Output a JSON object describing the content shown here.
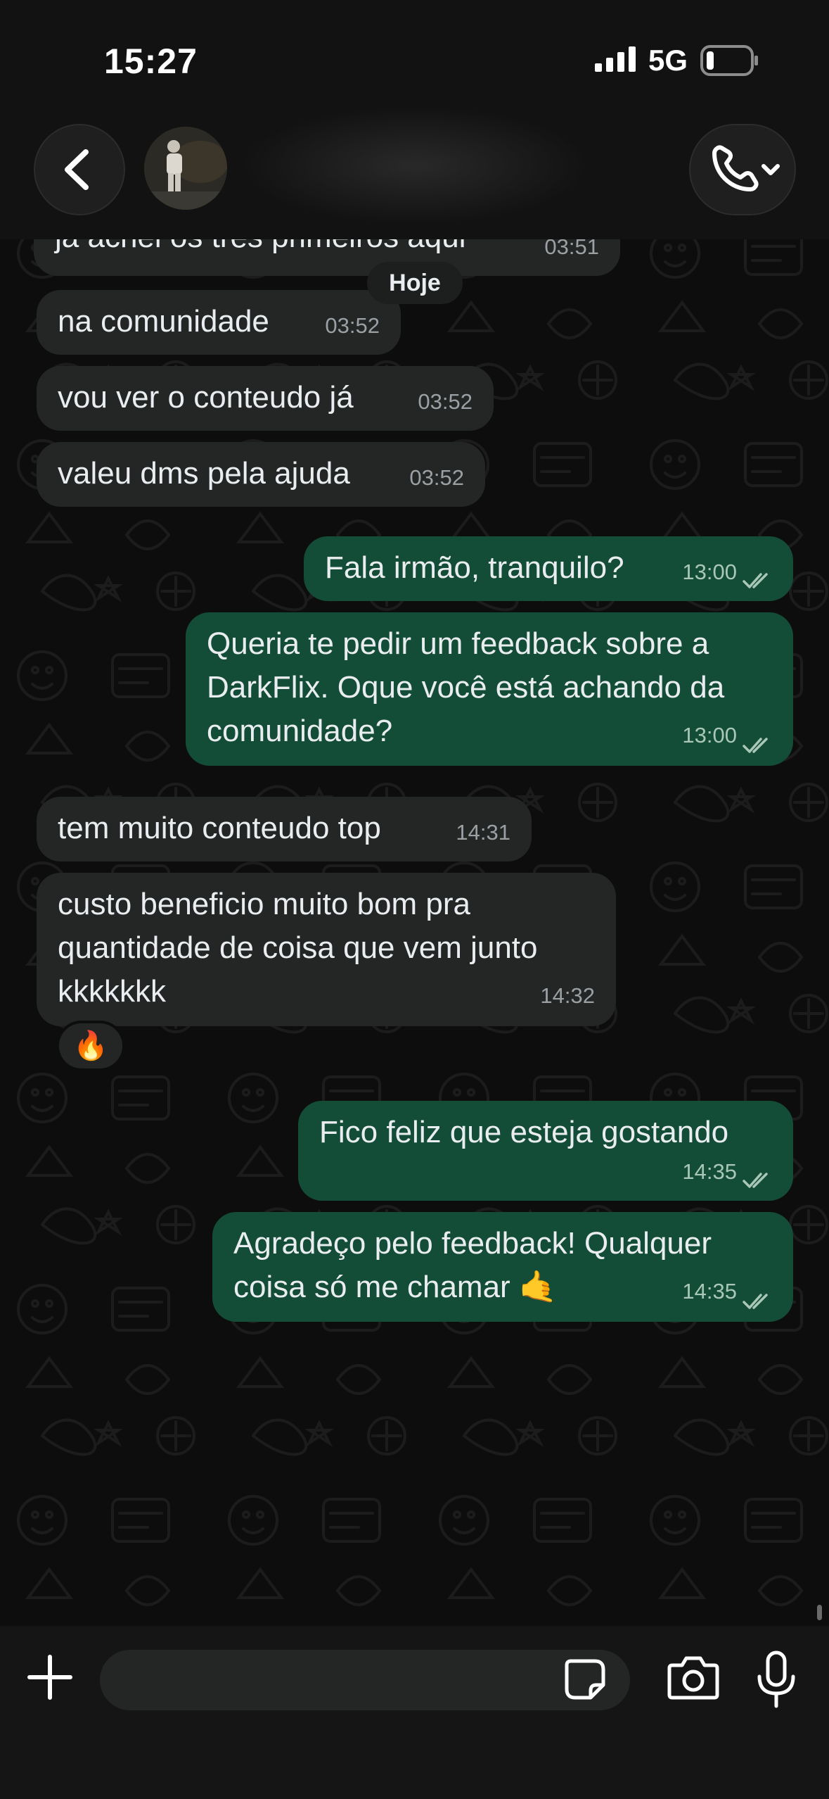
{
  "status_bar": {
    "time": "15:27",
    "network": "5G"
  },
  "chat": {
    "date_pill": "Hoje",
    "messages": [
      {
        "direction": "in",
        "lines": [
          "já achei os três primeiros aqui"
        ],
        "time": "03:51"
      },
      {
        "direction": "in",
        "lines": [
          "na comunidade"
        ],
        "time": "03:52"
      },
      {
        "direction": "in",
        "lines": [
          "vou ver o conteudo já"
        ],
        "time": "03:52"
      },
      {
        "direction": "in",
        "lines": [
          "valeu dms pela ajuda"
        ],
        "time": "03:52"
      },
      {
        "direction": "out",
        "lines": [
          "Fala irmão, tranquilo?"
        ],
        "time": "13:00",
        "status": "read"
      },
      {
        "direction": "out",
        "lines": [
          "Queria te pedir um feedback sobre a",
          "DarkFlix. Oque você está achando da",
          "comunidade?"
        ],
        "time": "13:00",
        "status": "read"
      },
      {
        "direction": "in",
        "lines": [
          "tem muito conteudo top"
        ],
        "time": "14:31"
      },
      {
        "direction": "in",
        "lines": [
          "custo beneficio muito bom pra",
          "quantidade de coisa que vem junto",
          "kkkkkkk"
        ],
        "time": "14:32",
        "reaction": "🔥"
      },
      {
        "direction": "out",
        "lines": [
          "Fico feliz que esteja gostando"
        ],
        "time": "14:35",
        "status": "read"
      },
      {
        "direction": "out",
        "lines": [
          "Agradeço pelo feedback! Qualquer",
          "coisa só me chamar 🤙"
        ],
        "time": "14:35",
        "status": "read"
      }
    ]
  },
  "composer": {
    "placeholder": ""
  },
  "icons": {
    "back": "chevron-left-icon",
    "call": "phone-icon",
    "attach": "plus-icon",
    "sticker": "sticker-icon",
    "camera": "camera-icon",
    "mic": "microphone-icon",
    "read": "double-check-icon"
  },
  "colors": {
    "incoming_bubble": "#242626",
    "outgoing_bubble": "#144d37",
    "background": "#0d0d0d"
  }
}
